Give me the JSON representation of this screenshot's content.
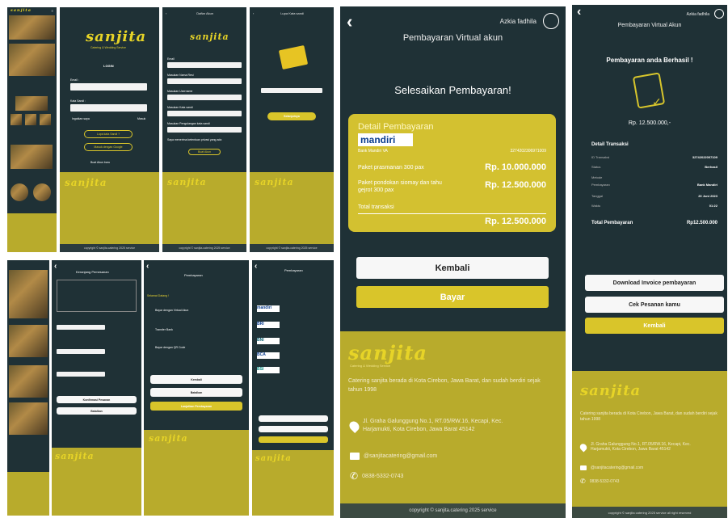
{
  "brand": {
    "logo": "sanjita",
    "tagline": "Catering & Wedding Service"
  },
  "login": {
    "title": "LOGIN",
    "email_label": "Email :",
    "password_label": "Kata Sandi :",
    "remember": "Ingatkan saya",
    "forgot": "Masuk",
    "btn_primary": "Lupa kata Sandi ?",
    "btn_secondary": "Masuk dengan Google",
    "register": "Buat Akun baru"
  },
  "register": {
    "title": "Daftar Akun",
    "fields": [
      "Email",
      "Masukan Nama Resi",
      "Masukan Username",
      "Masukan Kata sandi",
      "Masukan Pengulangan kata sandi"
    ],
    "agree": "Saya menerima ketentuan privasi yang ada",
    "btn": "Buat Akun"
  },
  "verify": {
    "title": "Lupa Kata sandi",
    "btn": "Selanjutnya"
  },
  "paket": {
    "title": "Keranjang Pemesanan",
    "btn_confirm": "Konfirmasi Pesanan",
    "btn_cancel": "Batalkan"
  },
  "pembayaran_menu": {
    "title": "Pembayaran",
    "header": "Selamat Datang !",
    "options": [
      "Bayar dengan Virtual Akun",
      "Transfer Bank",
      "Bayar dengan QR Code"
    ],
    "btn_back": "Kembali",
    "btn_cancel": "Batalkan",
    "btn_next": "Lanjutkan Pembayaran"
  },
  "bank_list": {
    "title": "Pembayaran",
    "banks": [
      "mandiri",
      "BRI",
      "BNI",
      "BCA",
      "BSI"
    ]
  },
  "va": {
    "user": "Azkia fadhila",
    "title": "Pembayaran Virtual akun",
    "heading": "Selesaikan Pembayaran!",
    "card_title": "Detail Pembayaran",
    "bank_logo": "mandiri",
    "bank_sub": "Bank Mandiri VA",
    "va_number": "3274202306971009",
    "items": [
      {
        "label": "Paket prasmanan 300 pax",
        "value": "Rp. 10.000.000"
      },
      {
        "label": "Paket pondokan siomay dan tahu gejrot 300 pax",
        "value": "Rp. 12.500.000"
      }
    ],
    "total_label": "Total transaksi",
    "total": "Rp. 12.500.000",
    "btn_back": "Kembali",
    "btn_pay": "Bayar"
  },
  "footer": {
    "about": "Catering sanjita berada di Kota Cirebon, Jawa Barat, dan sudah berdiri sejak tahun 1998",
    "address": "Jl. Graha Galunggung No.1, RT.05/RW.16, Kecapi, Kec. Harjamukti, Kota Cirebon, Jawa Barat 45142",
    "email": "@sanjitacatering@gmail.com",
    "phone": "0838-5332-0743",
    "copyright": "copyright © sanjita.catering 2025 service"
  },
  "success": {
    "user": "Azkia fadhila",
    "title": "Pembayaran Virtual Akun",
    "heading": "Pembayaran anda Berhasil !",
    "amount": "Rp. 12.500.000,-",
    "detail_title": "Detail Transaksi",
    "rows": [
      {
        "k": "ID Transaksi",
        "v": "32742022007109"
      },
      {
        "k": "Status",
        "v": "Berhasil"
      },
      {
        "k": "Metode",
        "v": ""
      },
      {
        "k": "Pembayaran",
        "v": "Bank Mandiri"
      },
      {
        "k": "Tanggal",
        "v": "20 Juni 2023"
      },
      {
        "k": "Waktu",
        "v": "01:22"
      }
    ],
    "total_label": "Total Pembayaran",
    "total": "Rp12.500.000",
    "btn_invoice": "Download Invoice pembayaran",
    "btn_check": "Cek Pesanan kamu",
    "btn_back": "Kembali",
    "copyright": "copyright © sanjita catering 2025 service all right reserved"
  },
  "colors": {
    "bg": "#1f3136",
    "gold": "#e6d232",
    "footer": "#b8ab2c"
  }
}
